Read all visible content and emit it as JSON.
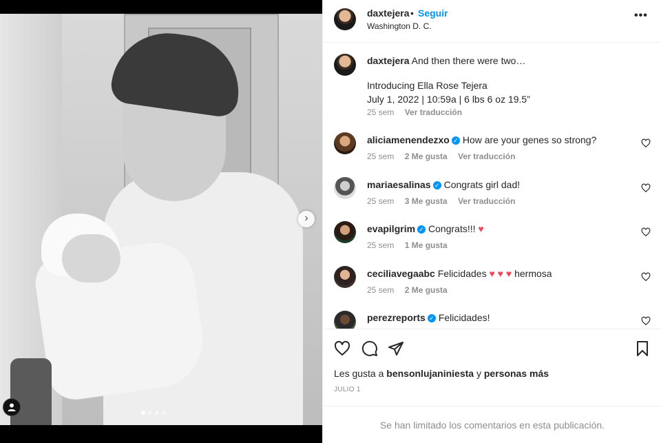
{
  "header": {
    "username": "daxtejera",
    "separator": "•",
    "follow_label": "Seguir",
    "location": "Washington D. C.",
    "more_label": "•••"
  },
  "caption": {
    "username": "daxtejera",
    "line1": "And then there were two…",
    "line2": "Introducing Ella Rose Tejera",
    "line3": "July 1, 2022 | 10:59a | 6 lbs 6 oz 19.5”",
    "time": "25 sem",
    "translate": "Ver traducción"
  },
  "comments": [
    {
      "username": "aliciamenendezxo",
      "verified": true,
      "text": "How are your genes so strong?",
      "time": "25 sem",
      "likes": "2 Me gusta",
      "translate": "Ver traducción",
      "avatar": "alicia-avatar"
    },
    {
      "username": "mariaesalinas",
      "verified": true,
      "text": "Congrats girl dad!",
      "time": "25 sem",
      "likes": "3 Me gusta",
      "translate": "Ver traducción",
      "avatar": "maria-avatar"
    },
    {
      "username": "evapilgrim",
      "verified": true,
      "text": "Congrats!!!",
      "hearts": "♥",
      "time": "25 sem",
      "likes": "1 Me gusta",
      "avatar": "eva-avatar"
    },
    {
      "username": "ceciliavegaabc",
      "verified": false,
      "text": "Felicidades",
      "hearts": "♥ ♥ ♥",
      "text_after": "hermosa",
      "time": "25 sem",
      "likes": "2 Me gusta",
      "avatar": "cecilia-avatar"
    },
    {
      "username": "perezreports",
      "verified": true,
      "text": "Felicidades!",
      "avatar": "perez-avatar"
    }
  ],
  "likes": {
    "prefix": "Les gusta a",
    "user": "bensonlujaniniesta",
    "connector": "y",
    "others": "personas más"
  },
  "date": "JULIO 1",
  "comments_limited": "Se han limitado los comentarios en esta publicación.",
  "carousel": {
    "slides": 4,
    "active_index": 0,
    "next_icon": "chevron-right-icon"
  },
  "icons": [
    "heart-icon",
    "comment-icon",
    "share-icon",
    "bookmark-icon",
    "user-tag-icon",
    "more-icon",
    "verified-icon"
  ],
  "colors": {
    "accent": "#0095f6",
    "heart": "#ed4956",
    "muted": "#8e8e8e"
  }
}
